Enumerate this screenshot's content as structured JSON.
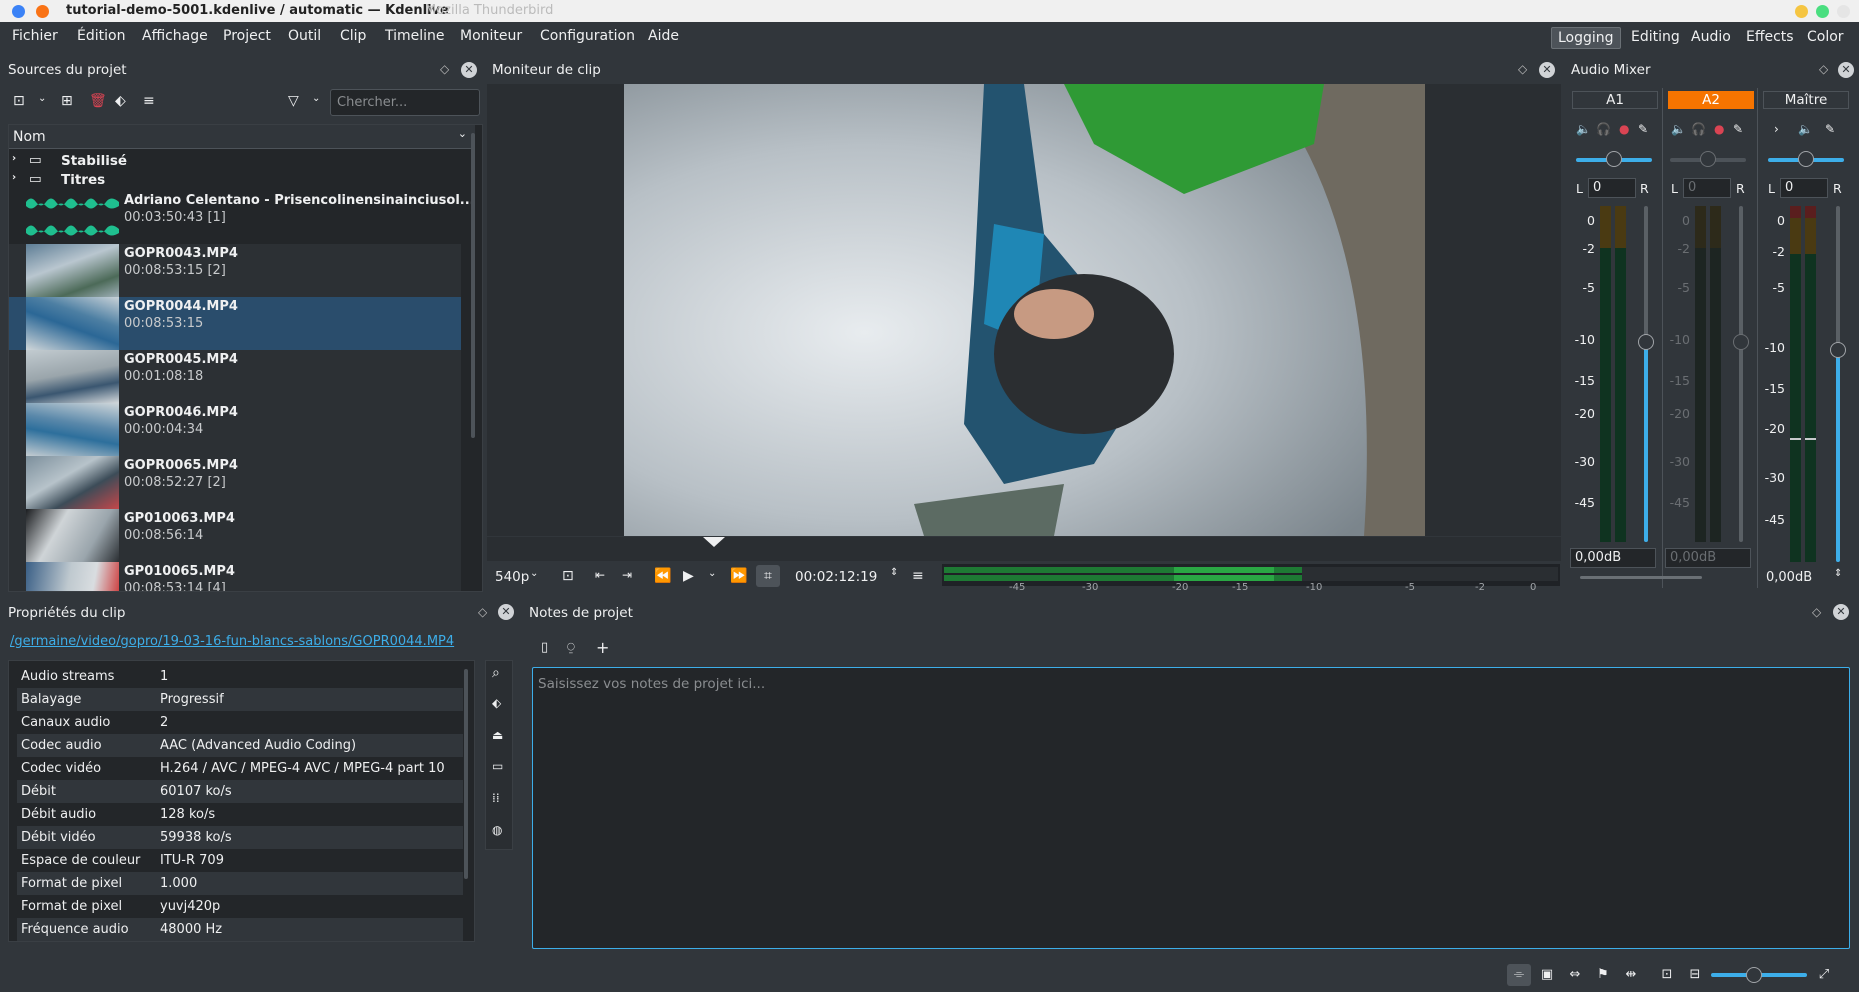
{
  "window": {
    "title": "tutorial-demo-5001.kdenlive / automatic — Kdenlive",
    "ghost_title": "Mozilla Thunderbird"
  },
  "menu": [
    "Fichier",
    "Édition",
    "Affichage",
    "Project",
    "Outil",
    "Clip",
    "Timeline",
    "Moniteur",
    "Configuration",
    "Aide"
  ],
  "layouts": [
    {
      "label": "Logging",
      "active": true
    },
    {
      "label": "Editing",
      "active": false
    },
    {
      "label": "Audio",
      "active": false
    },
    {
      "label": "Effects",
      "active": false
    },
    {
      "label": "Color",
      "active": false
    }
  ],
  "project_bin": {
    "title": "Sources du projet",
    "search_placeholder": "Chercher...",
    "column_header": "Nom",
    "folders": [
      "Stabilisé",
      "Titres"
    ],
    "clips": [
      {
        "name": "Adriano Celentano - Prisencolinensinainciusol...",
        "duration": "00:03:50:43 [1]",
        "kind": "audio"
      },
      {
        "name": "GOPR0043.MP4",
        "duration": "00:08:53:15 [2]",
        "kind": "video"
      },
      {
        "name": "GOPR0044.MP4",
        "duration": "00:08:53:15",
        "kind": "video",
        "selected": true
      },
      {
        "name": "GOPR0045.MP4",
        "duration": "00:01:08:18",
        "kind": "video"
      },
      {
        "name": "GOPR0046.MP4",
        "duration": "00:00:04:34",
        "kind": "video"
      },
      {
        "name": "GOPR0065.MP4",
        "duration": "00:08:52:27 [2]",
        "kind": "video"
      },
      {
        "name": "GP010063.MP4",
        "duration": "00:08:56:14",
        "kind": "video"
      },
      {
        "name": "GP010065.MP4",
        "duration": "00:08:53:14 [4]",
        "kind": "video"
      }
    ]
  },
  "clip_monitor": {
    "title": "Moniteur de clip",
    "resolution": "540p",
    "timecode": "00:02:12:19",
    "audio_scale": [
      "-45",
      "-30",
      "-20",
      "-15",
      "-10",
      "-5",
      "-2",
      "0"
    ]
  },
  "mixer": {
    "title": "Audio Mixer",
    "channels": [
      {
        "label": "A1",
        "active": false,
        "lr_value": "0",
        "gain": "0,00dB",
        "fader_level": 0.5
      },
      {
        "label": "A2",
        "active": true,
        "lr_value": "0",
        "gain": "0,00dB",
        "fader_level": 0.5
      },
      {
        "label": "Maître",
        "active": false,
        "lr_value": "0",
        "gain": "0,00dB",
        "fader_level": 0.5
      }
    ],
    "db_scale_a": [
      "0",
      "-2",
      "-5",
      "-10",
      "-15",
      "-20",
      "-30",
      "-45"
    ],
    "db_scale_master": [
      "0",
      "-2",
      "-5",
      "-10",
      "-15",
      "-20",
      "-30",
      "-45"
    ],
    "lr": {
      "left": "L",
      "right": "R"
    }
  },
  "clip_props": {
    "title": "Propriétés du clip",
    "path": "/germaine/video/gopro/19-03-16-fun-blancs-sablons/GOPR0044.MP4",
    "rows": [
      {
        "k": "Audio streams",
        "v": "1"
      },
      {
        "k": "Balayage",
        "v": "Progressif"
      },
      {
        "k": "Canaux audio",
        "v": "2"
      },
      {
        "k": "Codec audio",
        "v": "AAC (Advanced Audio Coding)"
      },
      {
        "k": "Codec vidéo",
        "v": "H.264 / AVC / MPEG-4 AVC / MPEG-4 part 10"
      },
      {
        "k": "Débit",
        "v": "60107 ko/s"
      },
      {
        "k": "Débit audio",
        "v": "128 ko/s"
      },
      {
        "k": "Débit vidéo",
        "v": "59938 ko/s"
      },
      {
        "k": "Espace de couleur",
        "v": "ITU-R 709"
      },
      {
        "k": "Format de pixel",
        "v": "1.000"
      },
      {
        "k": "Format de pixel",
        "v": "yuvj420p"
      },
      {
        "k": "Fréquence audio",
        "v": "48000 Hz"
      }
    ]
  },
  "notes": {
    "title": "Notes de projet",
    "placeholder": "Saisissez vos notes de projet ici..."
  },
  "colors": {
    "accent": "#3daee9",
    "selection": "#2a4d6c",
    "active_channel": "#f67400",
    "window_bg": "#31363b"
  }
}
